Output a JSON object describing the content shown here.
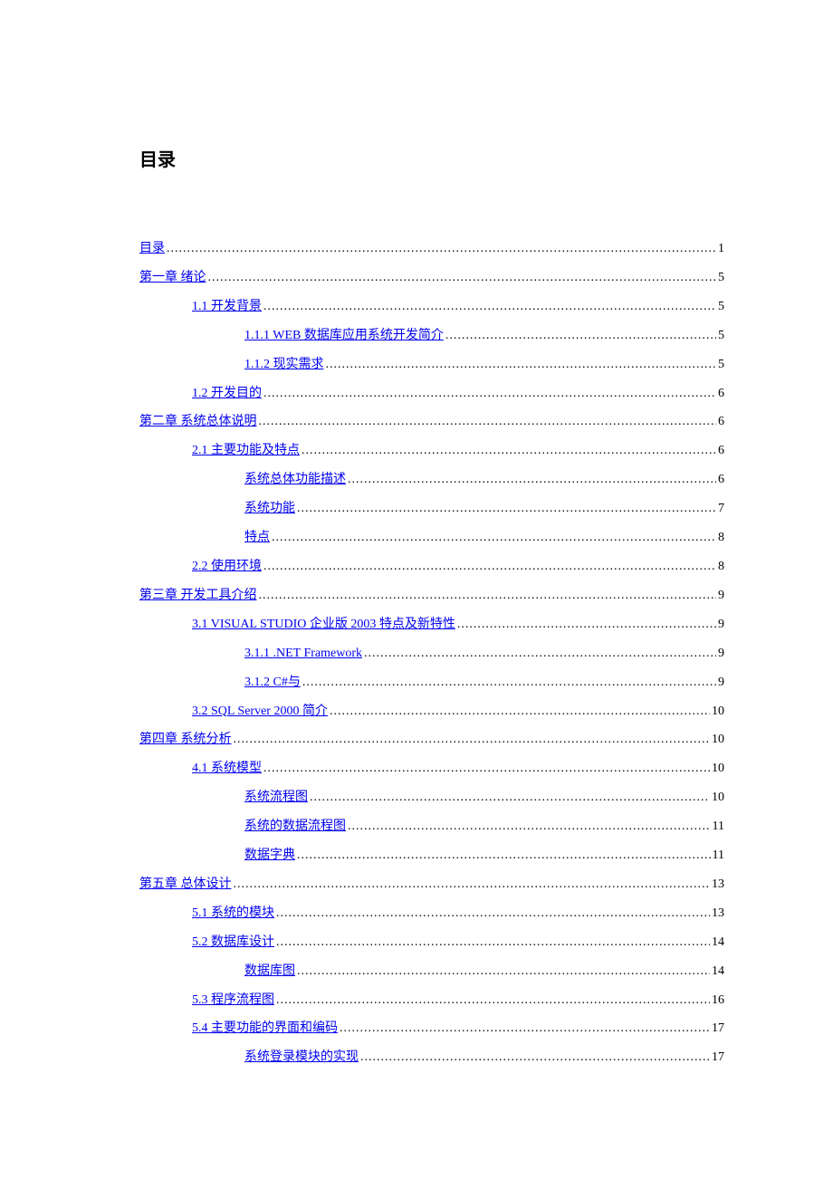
{
  "title": "目录",
  "entries": [
    {
      "label": "目录",
      "page": "1",
      "indent": 0
    },
    {
      "label": "第一章 绪论",
      "page": "5",
      "indent": 0
    },
    {
      "label": "1.1 开发背景",
      "page": "5",
      "indent": 1
    },
    {
      "label": "1.1.1    WEB 数据库应用系统开发简介",
      "page": "5",
      "indent": 2
    },
    {
      "label": "1.1.2    现实需求",
      "page": "5",
      "indent": 2
    },
    {
      "label": "1.2 开发目的",
      "page": "6",
      "indent": 1
    },
    {
      "label": "第二章 系统总体说明",
      "page": "6",
      "indent": 0
    },
    {
      "label": "2.1 主要功能及特点",
      "page": "6",
      "indent": 1
    },
    {
      "label": "系统总体功能描述",
      "page": "6",
      "indent": 2
    },
    {
      "label": "系统功能",
      "page": "7",
      "indent": 2
    },
    {
      "label": "特点",
      "page": "8",
      "indent": 2
    },
    {
      "label": "2.2 使用环境",
      "page": "8",
      "indent": 1
    },
    {
      "label": "第三章 开发工具介绍",
      "page": "9",
      "indent": 0
    },
    {
      "label": "3.1  VISUAL STUDIO 企业版 2003 特点及新特性",
      "page": "9",
      "indent": 1
    },
    {
      "label": "3.1.1   .NET Framework",
      "page": "9",
      "indent": 2
    },
    {
      "label": "3.1.2   C#与",
      "page": "9",
      "indent": 2
    },
    {
      "label": "3.2  SQL Server 2000 简介",
      "page": "10",
      "indent": 1
    },
    {
      "label": "第四章 系统分析",
      "page": "10",
      "indent": 0
    },
    {
      "label": "4.1 系统模型",
      "page": "10",
      "indent": 1
    },
    {
      "label": "系统流程图",
      "page": "10",
      "indent": 2
    },
    {
      "label": "系统的数据流程图",
      "page": "11",
      "indent": 2
    },
    {
      "label": "数据字典",
      "page": "11",
      "indent": 2
    },
    {
      "label": "第五章 总体设计",
      "page": "13",
      "indent": 0
    },
    {
      "label": "5.1 系统的模块",
      "page": "13",
      "indent": 1
    },
    {
      "label": "5.2 数据库设计",
      "page": "14",
      "indent": 1
    },
    {
      "label": "数据库图",
      "page": "14",
      "indent": 2
    },
    {
      "label": "5.3  程序流程图",
      "page": "16",
      "indent": 1
    },
    {
      "label": "5.4 主要功能的界面和编码",
      "page": "17",
      "indent": 1
    },
    {
      "label": "系统登录模块的实现",
      "page": "17",
      "indent": 2
    }
  ]
}
